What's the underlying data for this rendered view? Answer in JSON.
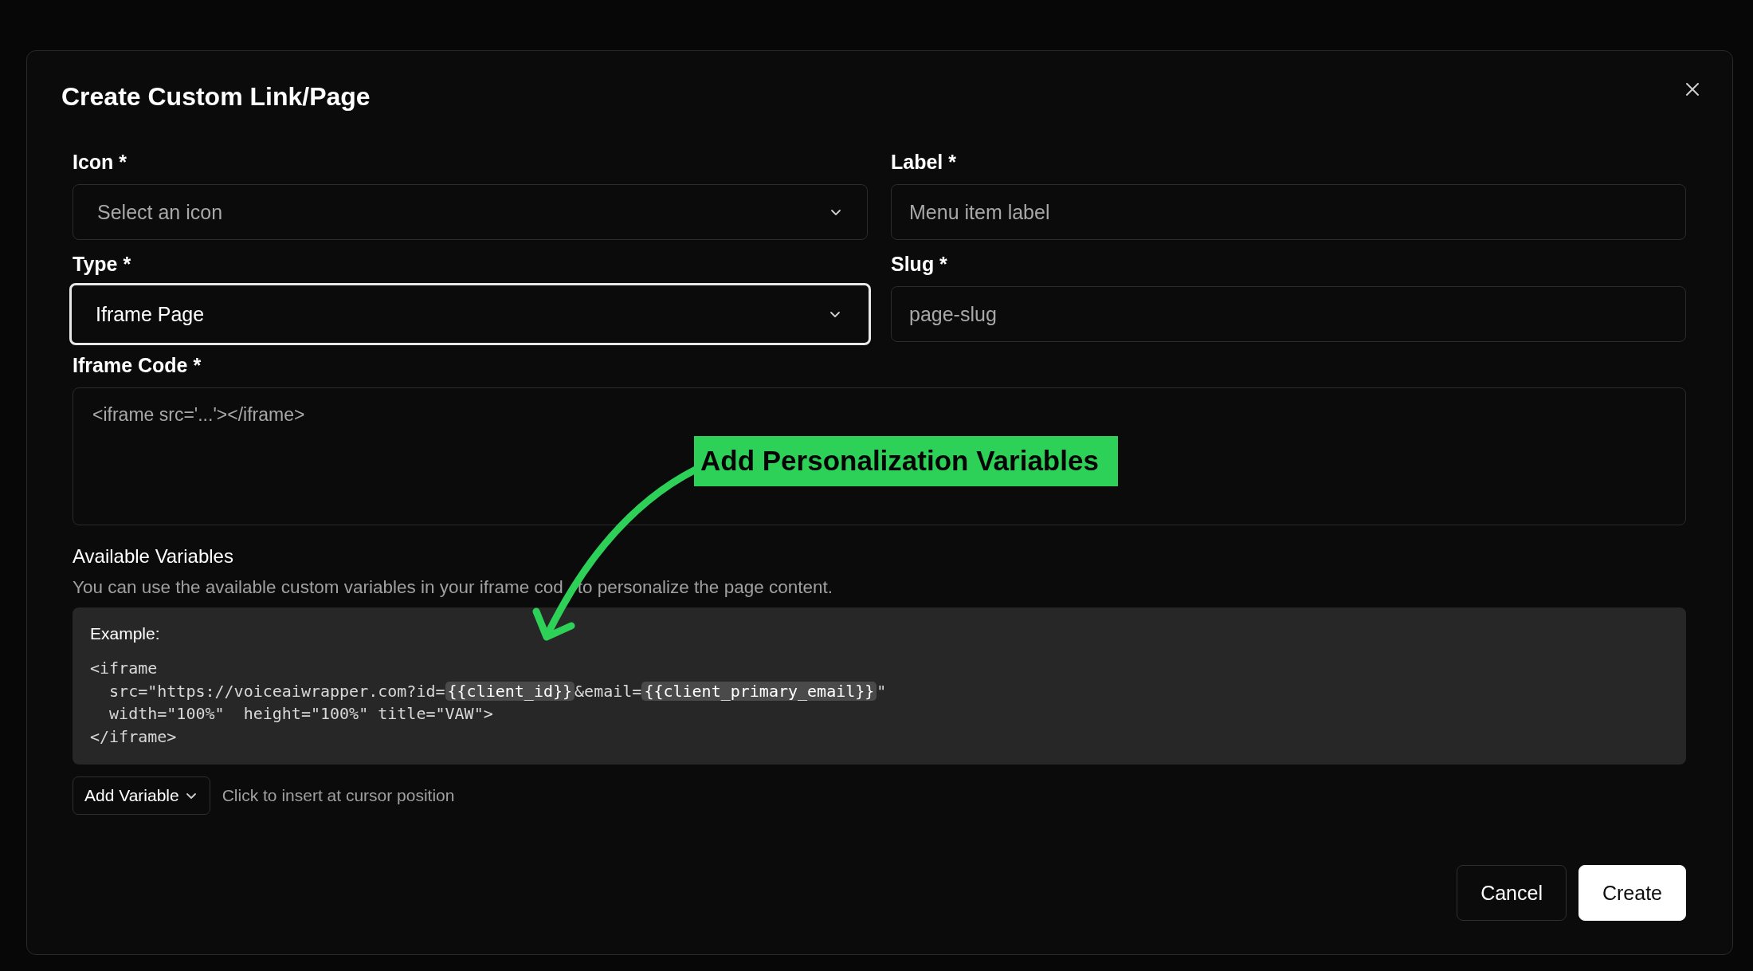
{
  "dialog": {
    "title": "Create Custom Link/Page",
    "fields": [
      {
        "label": "Icon *",
        "kind": "select",
        "placeholder": "Select an icon",
        "focused": false
      },
      {
        "label": "Label *",
        "kind": "input",
        "placeholder": "Menu item label",
        "focused": false
      },
      {
        "label": "Type *",
        "kind": "select",
        "value": "Iframe Page",
        "focused": true
      },
      {
        "label": "Slug *",
        "kind": "input",
        "placeholder": "page-slug",
        "focused": false
      }
    ],
    "iframe_code": {
      "label": "Iframe Code *",
      "placeholder": "<iframe src='...'></iframe>"
    },
    "variables": {
      "title": "Available Variables",
      "description": [
        "You can use the available custom variables in your iframe cod",
        "to personalize the page content."
      ],
      "example_label": "Example:",
      "example_lines": [
        [
          {
            "kind": "text",
            "text": "<iframe"
          }
        ],
        [
          {
            "kind": "text",
            "text": "  src=\"https://voiceaiwrapper.com?id="
          },
          {
            "kind": "variable",
            "text": "{{client_id}}"
          },
          {
            "kind": "text",
            "text": "&email="
          },
          {
            "kind": "variable",
            "text": "{{client_primary_email}}"
          },
          {
            "kind": "text",
            "text": "\""
          }
        ],
        [
          {
            "kind": "text",
            "text": "  width=\"100%\"  height=\"100%\" title=\"VAW\">"
          }
        ],
        [
          {
            "kind": "text",
            "text": "</iframe>"
          }
        ]
      ],
      "add_button": "Add Variable",
      "hint": "Click to insert at cursor position"
    },
    "buttons": [
      {
        "label": "Cancel",
        "kind": "secondary"
      },
      {
        "label": "Create",
        "kind": "primary"
      }
    ]
  },
  "annotation": {
    "text": "Add Personalization Variables"
  }
}
